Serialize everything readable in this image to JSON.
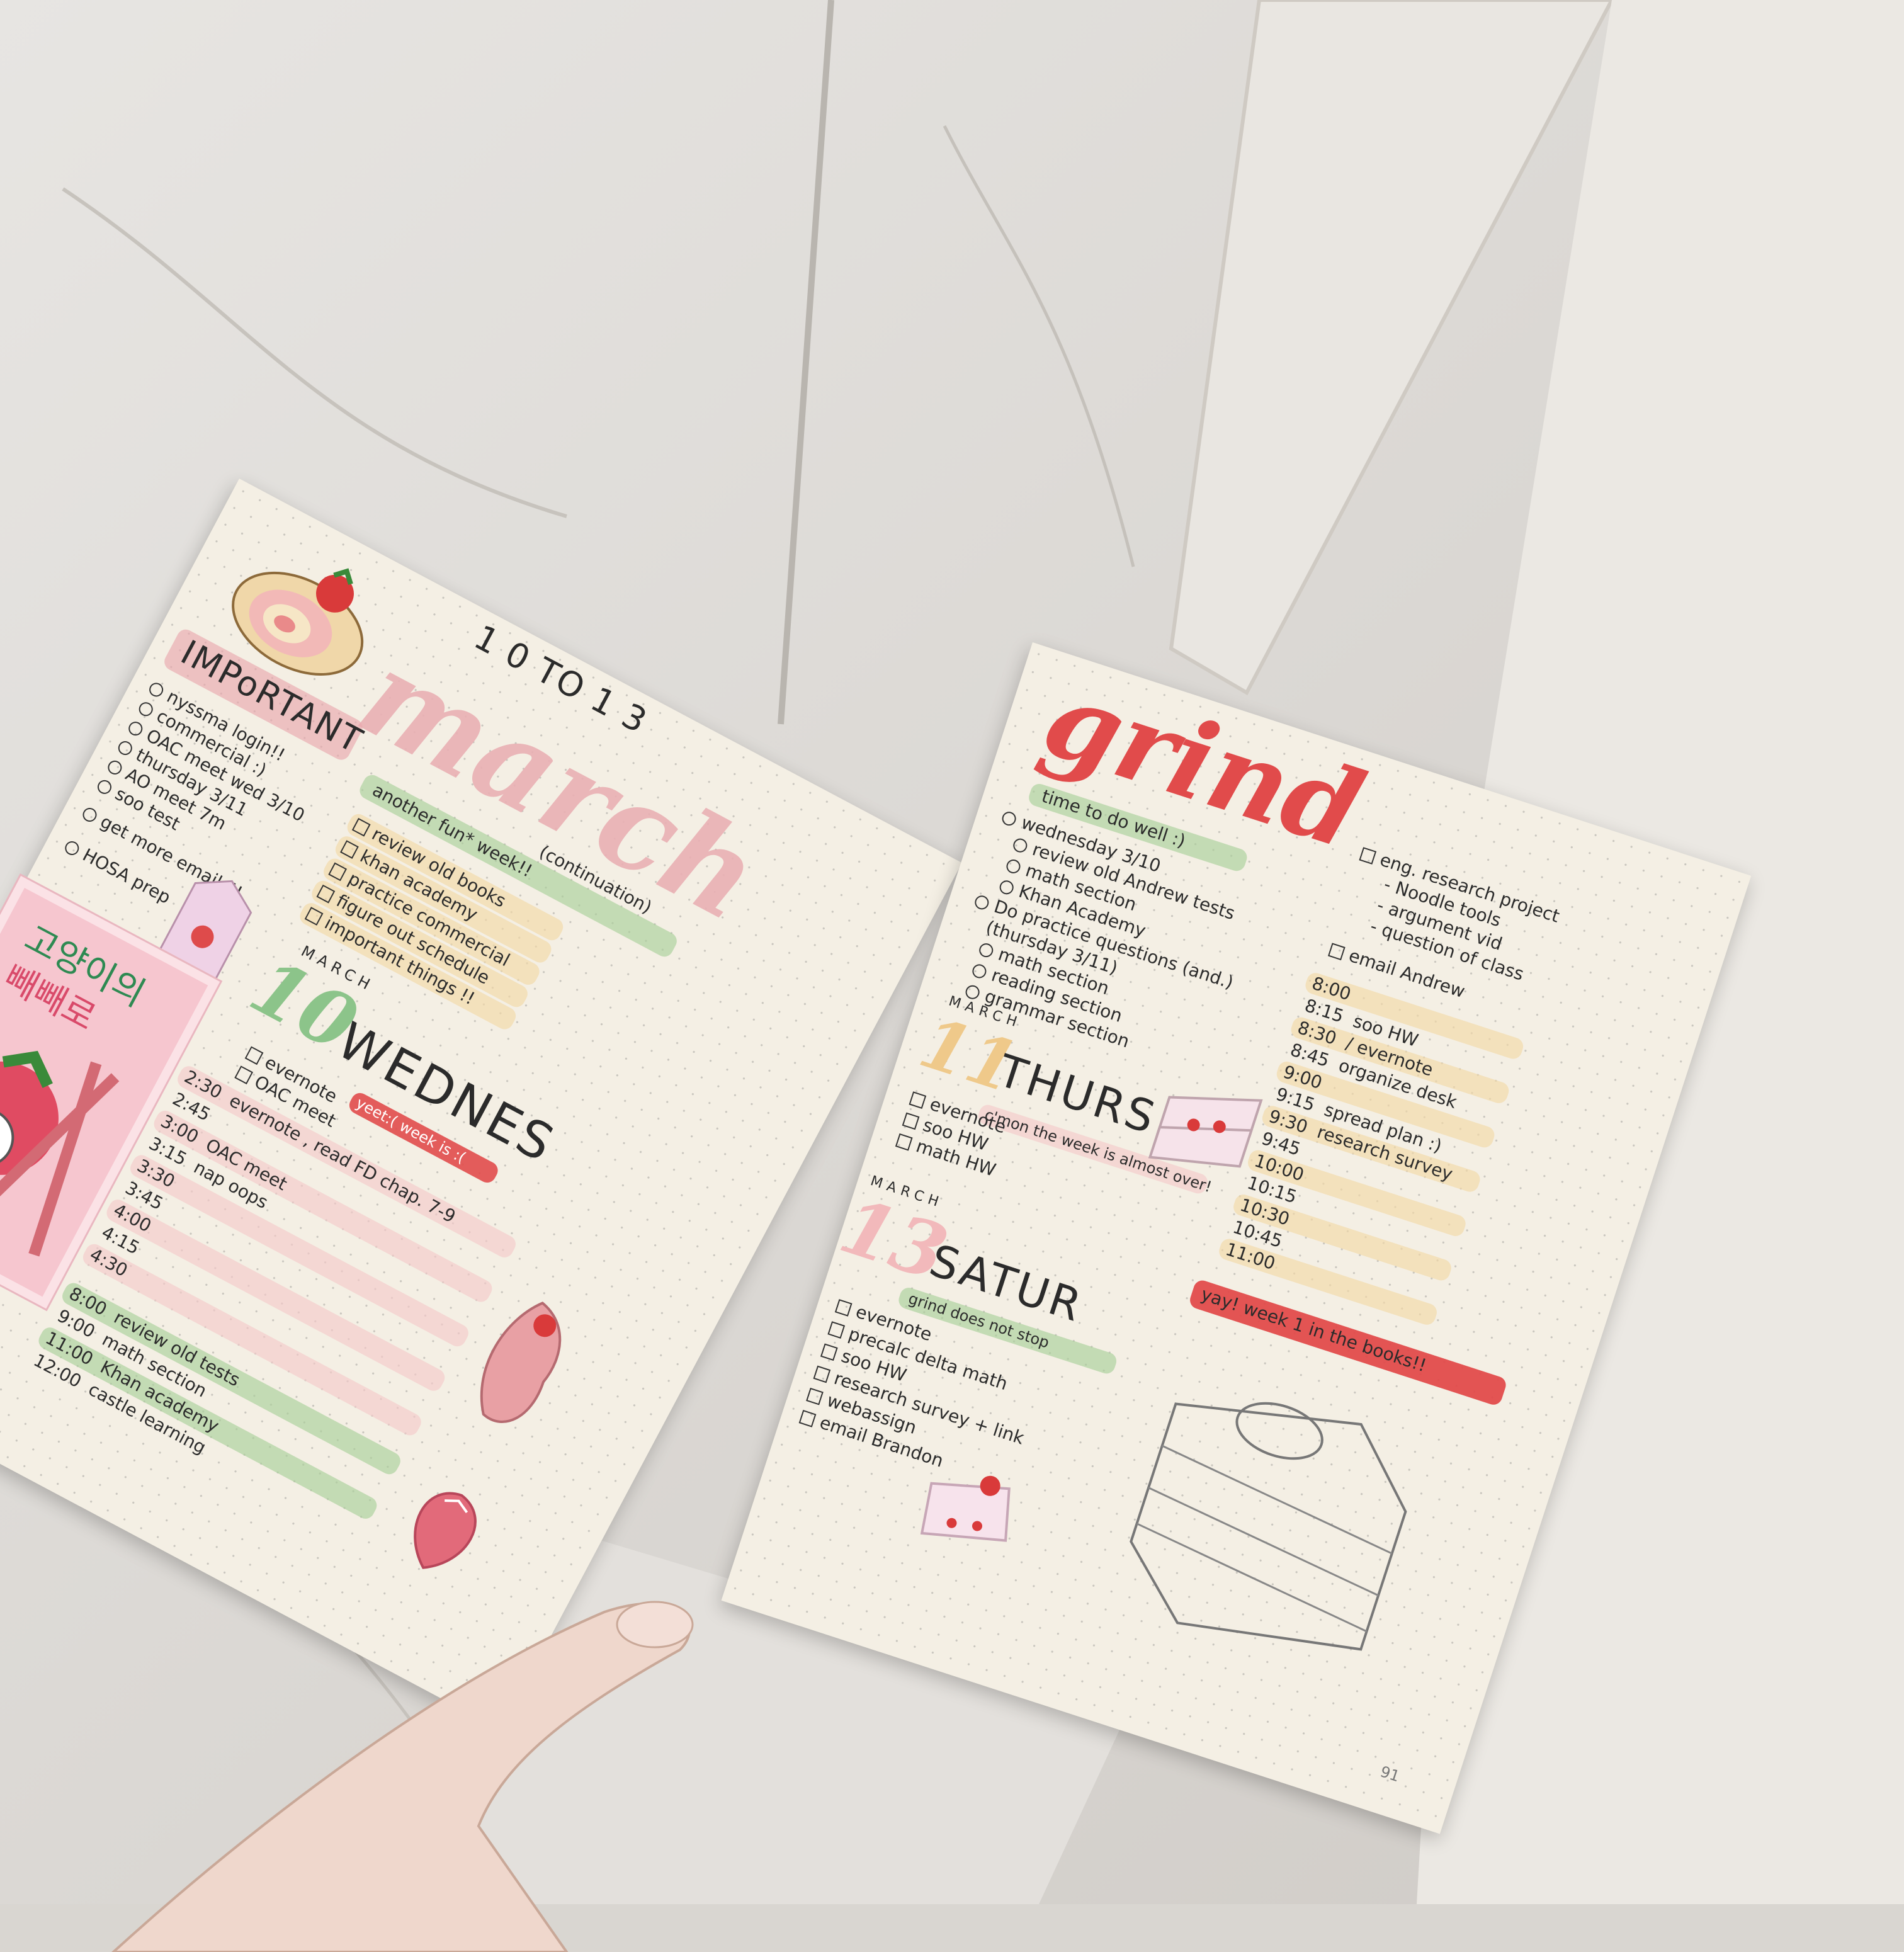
{
  "left_page": {
    "header": {
      "date_range": "1 0 TO 1 3",
      "month": "march",
      "continuation": "(continuation)",
      "subtitle": "another fun* week!!"
    },
    "important": {
      "title": "IMPoRTANT",
      "items": [
        "nyssma login!!",
        "commercial :)",
        "OAC meet wed 3/10",
        "thursday 3/11",
        "AO meet 7m",
        "soo test",
        "get more emails!!",
        "HOSA prep"
      ]
    },
    "review_list": {
      "items": [
        "review old books",
        "khan academy",
        "practice commercial",
        "figure out schedule",
        "important things !!"
      ]
    },
    "day_10": {
      "month_label": "MARCH",
      "day": "10",
      "weekday": "WEDNES",
      "tag": "yeet:( week is :(",
      "tasks": [
        "evernote",
        "OAC meet"
      ],
      "schedule": [
        {
          "time": "2:30",
          "task": "evernote , read FD chap. 7-9"
        },
        {
          "time": "2:45",
          "task": ""
        },
        {
          "time": "3:00",
          "task": "OAC meet"
        },
        {
          "time": "3:15",
          "task": "nap oops"
        },
        {
          "time": "3:30",
          "task": ""
        },
        {
          "time": "3:45",
          "task": ""
        },
        {
          "time": "4:00",
          "task": ""
        },
        {
          "time": "4:15",
          "task": ""
        },
        {
          "time": "4:30",
          "task": ""
        },
        {
          "time": "8:00",
          "task": "review old tests"
        },
        {
          "time": "9:00",
          "task": "math section"
        },
        {
          "time": "11:00",
          "task": "Khan academy"
        },
        {
          "time": "12:00",
          "task": "castle learning"
        }
      ]
    },
    "sticker": {
      "korean_line1": "고양이의",
      "korean_line2": "빼빼로"
    }
  },
  "right_page": {
    "title": "grind",
    "subtitle": "time to do well :)",
    "day_wed_list": [
      "wednesday 3/10",
      "review old Andrew tests",
      "math section",
      "Khan Academy",
      "Do practice questions (and.)",
      "(thursday 3/11)",
      "math section",
      "reading section",
      "grammar section"
    ],
    "research_list": [
      "eng. research project",
      "- Noodle tools",
      "- argument vid",
      "- question of class",
      "email Andrew"
    ],
    "day_11": {
      "month_label": "MARCH",
      "day": "11",
      "weekday": "THURS",
      "tag": "c'mon the week is almost over!",
      "tasks": [
        "evernote",
        "soo HW",
        "math HW"
      ]
    },
    "schedule_right": [
      {
        "time": "8:00",
        "task": ""
      },
      {
        "time": "8:15",
        "task": "soo HW"
      },
      {
        "time": "8:30",
        "task": "/ evernote"
      },
      {
        "time": "8:45",
        "task": "organize desk"
      },
      {
        "time": "9:00",
        "task": ""
      },
      {
        "time": "9:15",
        "task": "spread plan :)"
      },
      {
        "time": "9:30",
        "task": "research survey"
      },
      {
        "time": "9:45",
        "task": ""
      },
      {
        "time": "10:00",
        "task": ""
      },
      {
        "time": "10:15",
        "task": ""
      },
      {
        "time": "10:30",
        "task": ""
      },
      {
        "time": "10:45",
        "task": ""
      },
      {
        "time": "11:00",
        "task": ""
      }
    ],
    "banner": "yay! week 1 in the books!!",
    "day_13": {
      "month_label": "MARCH",
      "day": "13",
      "weekday": "SATUR",
      "tag": "grind does not stop",
      "tasks": [
        "evernote",
        "precalc delta math",
        "soo HW",
        "research survey + link",
        "webassign",
        "email Brandon"
      ]
    },
    "page_number": "91"
  },
  "colors": {
    "pink": "#e9a8ad",
    "light_pink": "#f4c9c9",
    "green": "#a9cf9a",
    "yellow": "#f3d9a6",
    "red": "#e14b4b",
    "paper": "#f4efe4"
  }
}
